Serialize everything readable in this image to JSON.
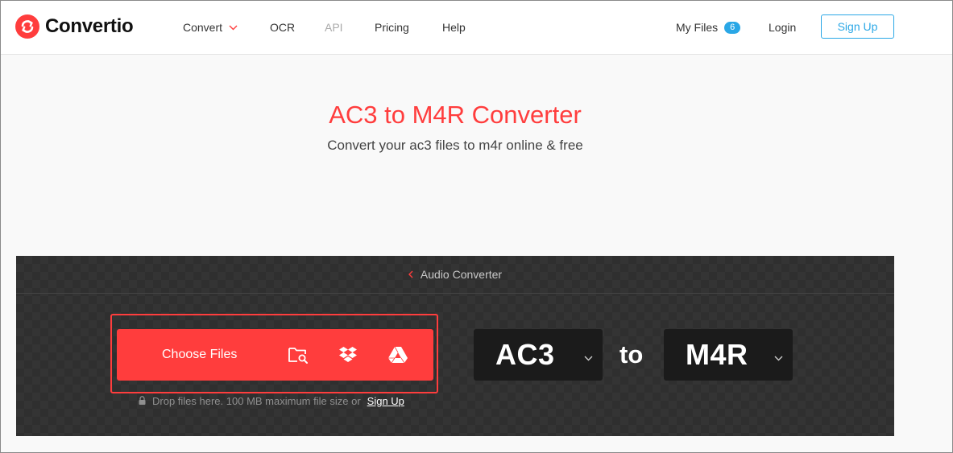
{
  "header": {
    "logo_text": "Convertio",
    "nav": {
      "convert": "Convert",
      "ocr": "OCR",
      "api": "API",
      "pricing": "Pricing",
      "help": "Help"
    },
    "my_files": "My Files",
    "my_files_count": "6",
    "login": "Login",
    "sign_up": "Sign Up"
  },
  "hero": {
    "title": "AC3 to M4R Converter",
    "subtitle": "Convert your ac3 files to m4r online & free"
  },
  "converter": {
    "breadcrumb": "Audio Converter",
    "choose_files": "Choose Files",
    "drop_hint": "Drop files here. 100 MB maximum file size or",
    "drop_hint_link": "Sign Up",
    "from_format": "AC3",
    "to_label": "to",
    "to_format": "M4R"
  },
  "icons": {
    "logo": "convertio-logo-icon",
    "convert_dropdown": "chevron-down-icon",
    "breadcrumb_back": "chevron-left-icon",
    "computer": "folder-search-icon",
    "dropbox": "dropbox-icon",
    "google_drive": "google-drive-icon",
    "lock": "lock-icon",
    "format_dropdown": "chevron-down-icon"
  },
  "colors": {
    "brand_red": "#ff3d3d",
    "accent_blue": "#2aa7e6",
    "panel_dark": "#2f2f2f",
    "format_box": "#1b1b1b"
  }
}
